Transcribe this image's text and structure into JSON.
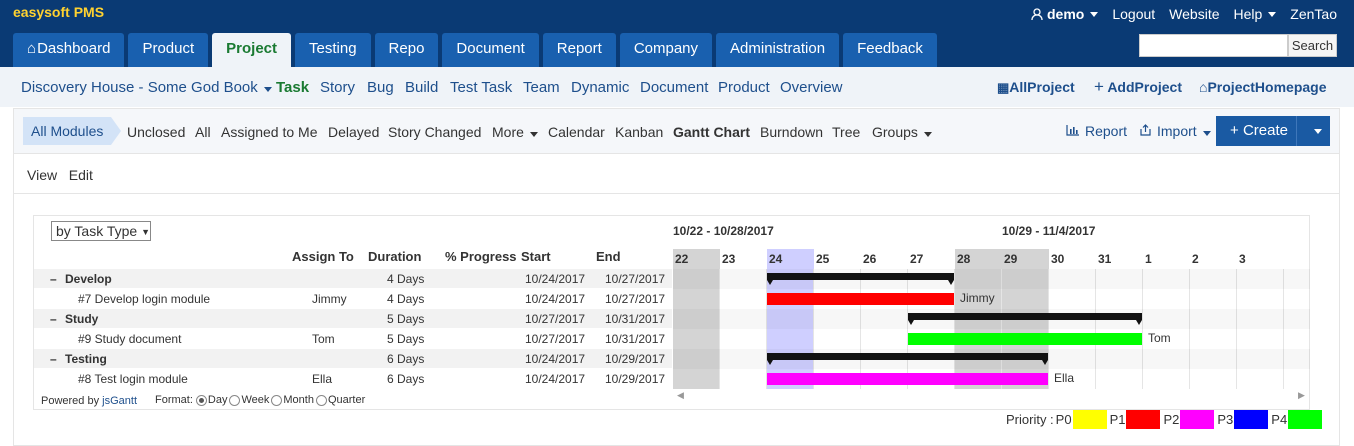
{
  "brand": "easysoft PMS",
  "topnav": {
    "user": "demo",
    "logout": "Logout",
    "website": "Website",
    "help": "Help",
    "zentao": "ZenTao"
  },
  "mainnav": [
    "Dashboard",
    "Product",
    "Project",
    "Testing",
    "Repo",
    "Document",
    "Report",
    "Company",
    "Administration",
    "Feedback"
  ],
  "search": {
    "placeholder": "",
    "button": "Search"
  },
  "subnav": {
    "project": "Discovery House - Some God Book",
    "items": [
      "Task",
      "Story",
      "Bug",
      "Build",
      "Test Task",
      "Team",
      "Dynamic",
      "Document",
      "Product",
      "Overview"
    ],
    "all_project": "AllProject",
    "add_project": "AddProject",
    "project_home": "ProjectHomepage"
  },
  "toolbar": {
    "all_modules": "All Modules",
    "items": [
      "Unclosed",
      "All",
      "Assigned to Me",
      "Delayed",
      "Story Changed",
      "More",
      "Calendar",
      "Kanban",
      "Gantt Chart",
      "Burndown",
      "Tree",
      "Groups"
    ],
    "report": "Report",
    "import": "Import",
    "create": "Create"
  },
  "view_edit": {
    "view": "View",
    "edit": "Edit"
  },
  "gantt": {
    "group_by": "by Task Type",
    "columns": [
      "Assign To",
      "Duration",
      "% Progress",
      "Start",
      "End"
    ],
    "rows": [
      {
        "type": "group",
        "toggle": "–",
        "name": "Develop",
        "assign": "",
        "duration": "4 Days",
        "start": "10/24/2017",
        "end": "10/27/2017"
      },
      {
        "type": "task",
        "name": "#7 Develop login module",
        "assign": "Jimmy",
        "duration": "4 Days",
        "start": "10/24/2017",
        "end": "10/27/2017",
        "color": "#ff0000"
      },
      {
        "type": "group",
        "toggle": "–",
        "name": "Study",
        "assign": "",
        "duration": "5 Days",
        "start": "10/27/2017",
        "end": "10/31/2017"
      },
      {
        "type": "task",
        "name": "#9 Study document",
        "assign": "Tom",
        "duration": "5 Days",
        "start": "10/27/2017",
        "end": "10/31/2017",
        "color": "#00ff00"
      },
      {
        "type": "group",
        "toggle": "–",
        "name": "Testing",
        "assign": "",
        "duration": "6 Days",
        "start": "10/24/2017",
        "end": "10/29/2017"
      },
      {
        "type": "task",
        "name": "#8 Test login module",
        "assign": "Ella",
        "duration": "6 Days",
        "start": "10/24/2017",
        "end": "10/29/2017",
        "color": "#ff00ff"
      }
    ],
    "powered_by": "Powered by",
    "powered_link": "jsGantt",
    "format_label": "Format:",
    "formats": [
      "Day",
      "Week",
      "Month",
      "Quarter"
    ],
    "format_selected": "Day",
    "weeks": [
      "10/22 - 10/28/2017",
      "10/29 - 11/4/2017"
    ],
    "days": [
      "22",
      "23",
      "24",
      "25",
      "26",
      "27",
      "28",
      "29",
      "30",
      "31",
      "1",
      "2",
      "3"
    ]
  },
  "priority": {
    "label": "Priority :",
    "items": [
      {
        "name": "P0",
        "color": "#ffff00"
      },
      {
        "name": "P1",
        "color": "#ff0000"
      },
      {
        "name": "P2",
        "color": "#ff00ff"
      },
      {
        "name": "P3",
        "color": "#0000ff"
      },
      {
        "name": "P4",
        "color": "#00ff00"
      }
    ]
  }
}
